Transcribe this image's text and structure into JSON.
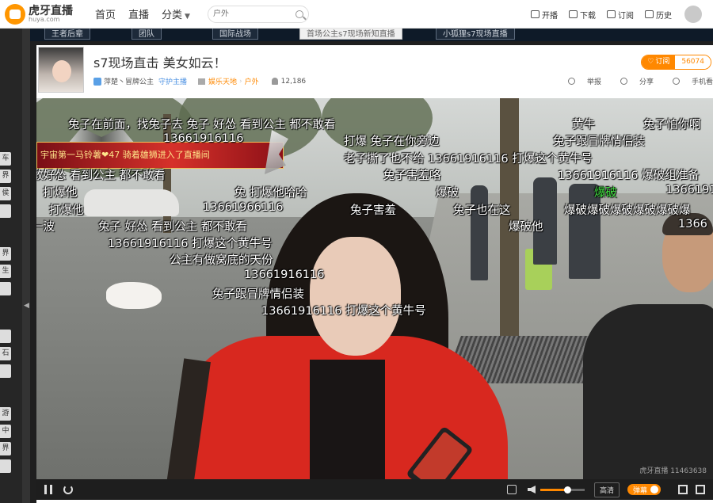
{
  "nav": {
    "logo_cn": "虎牙直播",
    "logo_en": "huya.com",
    "links": [
      "首页",
      "直播",
      "分类"
    ],
    "search_placeholder": "户外",
    "actions": [
      "开播",
      "下载",
      "订阅",
      "历史"
    ]
  },
  "sidebar": {
    "items": [
      "车",
      "界",
      "侯",
      "界",
      "生",
      "石",
      "游",
      "中区",
      "界"
    ]
  },
  "strip_tabs": [
    "王者后辈",
    "团队",
    "国际战场",
    "首场公主s7现场新知直播",
    "小狐狸s7现场直播"
  ],
  "room": {
    "title": "s7现场直击 美女如云！",
    "streamer": "萍楚丶冒牌公主",
    "guard": "守护主播",
    "category_parent": "娱乐天地",
    "category": "户外",
    "viewers": "12,186",
    "subscribe_label": "订阅",
    "subscribe_count": "56074",
    "actions": [
      "举报",
      "分享",
      "手机看"
    ]
  },
  "banner": {
    "text": "宇宙第一马铃薯❤47 骑着雄狮进入了直播间"
  },
  "danmaku": [
    {
      "text": "兔子在前面，找兔子去 兔子 好怂 看到公主 都不敢看",
      "color": "white"
    },
    {
      "text": "13661916116",
      "color": "white"
    },
    {
      "text": "黄牛",
      "color": "white"
    },
    {
      "text": "兔子怕你啊",
      "color": "white"
    },
    {
      "text": "打爆 兔子在你旁边",
      "color": "white"
    },
    {
      "text": "兔子跟冒牌情侣装",
      "color": "white"
    },
    {
      "text": "老子撕了也不给 13661916116 打爆这个黄牛号",
      "color": "white"
    },
    {
      "text": "敢好怂 看到公主 都不敢看",
      "color": "white"
    },
    {
      "text": "兔子害羞咯",
      "color": "white"
    },
    {
      "text": "13661916116 爆破组准备",
      "color": "white"
    },
    {
      "text": "打爆他",
      "color": "white"
    },
    {
      "text": "兔 打爆他哈哈",
      "color": "white"
    },
    {
      "text": "爆破",
      "color": "white"
    },
    {
      "text": "爆破",
      "color": "green"
    },
    {
      "text": "1366191",
      "color": "white"
    },
    {
      "text": "打爆他",
      "color": "white"
    },
    {
      "text": "13661966116",
      "color": "white"
    },
    {
      "text": "兔子害羞",
      "color": "white"
    },
    {
      "text": "兔子也在这",
      "color": "white"
    },
    {
      "text": "爆破爆破爆破爆破爆破爆",
      "color": "white"
    },
    {
      "text": "一波",
      "color": "white"
    },
    {
      "text": "兔子 好怂 看到公主 都不敢看",
      "color": "white"
    },
    {
      "text": "爆破他",
      "color": "white"
    },
    {
      "text": "1366",
      "color": "white"
    },
    {
      "text": "13661916116 打爆这个黄牛号",
      "color": "white"
    },
    {
      "text": "公主有做窝底的天份",
      "color": "white"
    },
    {
      "text": "13661916116",
      "color": "white"
    },
    {
      "text": "兔子跟冒牌情侣装",
      "color": "white"
    },
    {
      "text": "13661916116 打爆这个黄牛号",
      "color": "white"
    }
  ],
  "watermark": "虎牙直播 11463638",
  "controls": {
    "quality": "高清",
    "danmaku_toggle": "弹幕",
    "volume": 0.6
  }
}
